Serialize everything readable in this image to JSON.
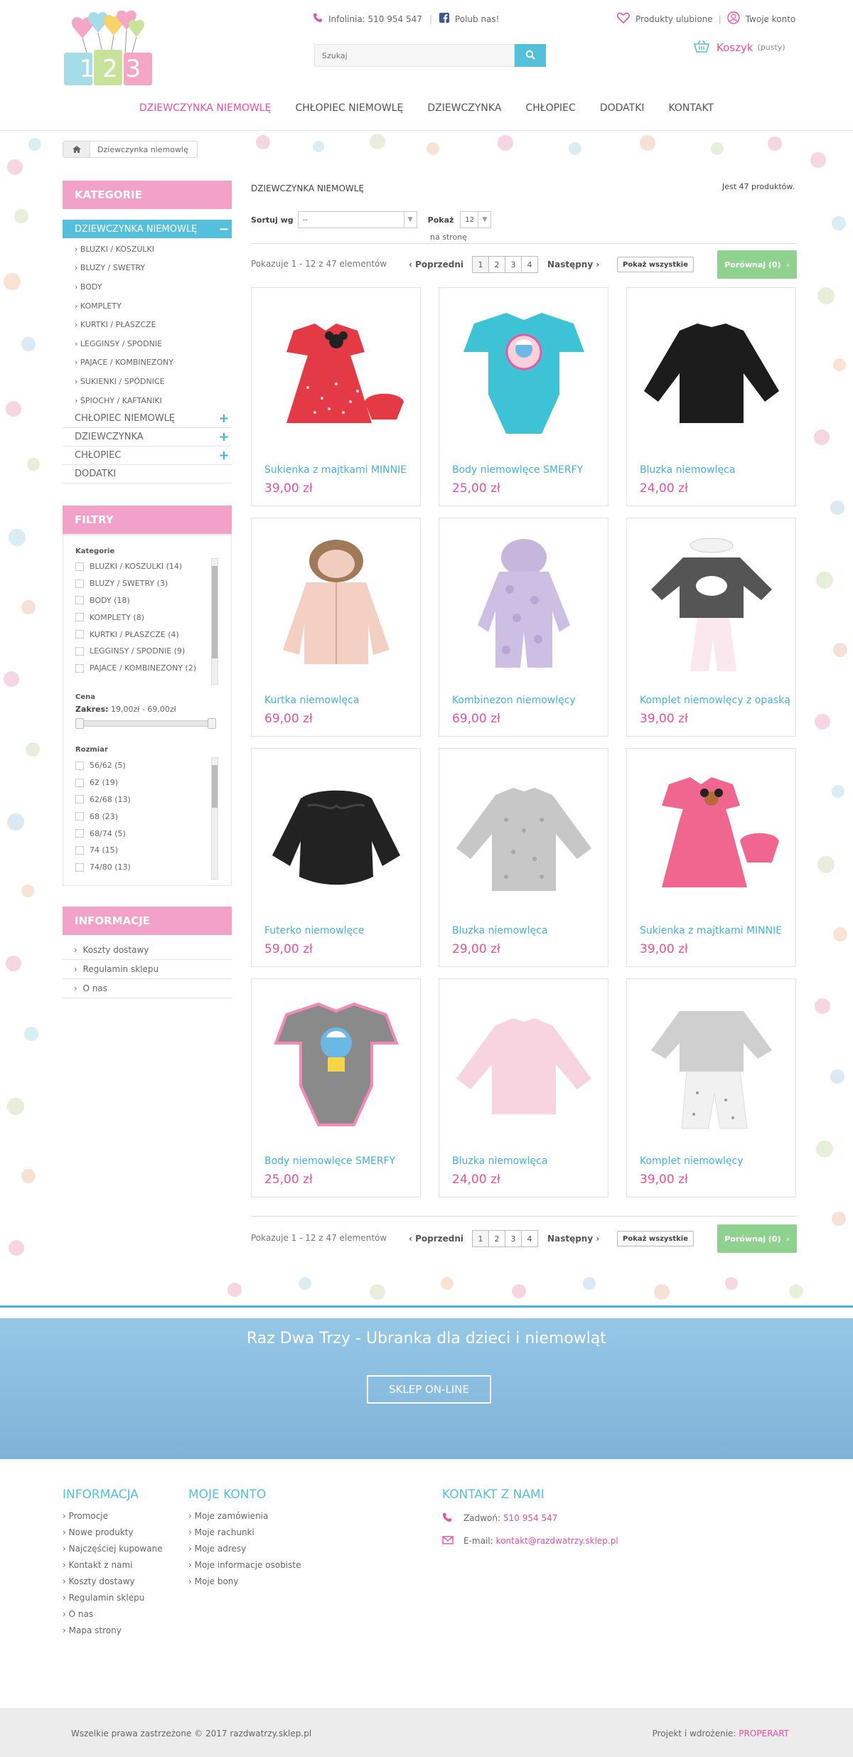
{
  "header": {
    "infoline_label": "Infolinia: 510 954 547",
    "facebook_label": "Polub nas!",
    "search_placeholder": "Szukaj",
    "favorites_label": "Produkty ulubione",
    "account_label": "Twoje konto",
    "cart_label": "Koszyk",
    "cart_status": "(pusty)",
    "logo_text": "1 2 3"
  },
  "nav": {
    "items": [
      "DZIEWCZYNKA NIEMOWLĘ",
      "CHŁOPIEC NIEMOWLĘ",
      "DZIEWCZYNKA",
      "CHŁOPIEC",
      "DODATKI",
      "KONTAKT"
    ],
    "active_index": 0
  },
  "breadcrumb": {
    "current": "Dziewczynka niemowlę"
  },
  "sidebar": {
    "categories_title": "KATEGORIE",
    "categories": [
      {
        "label": "DZIEWCZYNKA NIEMOWLĘ",
        "toggle": "−"
      },
      {
        "label": "CHŁOPIEC NIEMOWLĘ",
        "toggle": "+"
      },
      {
        "label": "DZIEWCZYNKA",
        "toggle": "+"
      },
      {
        "label": "CHŁOPIEC",
        "toggle": "+"
      },
      {
        "label": "DODATKI",
        "toggle": ""
      }
    ],
    "subcategories": [
      "BLUZKI / KOSZULKI",
      "BLUZY / SWETRY",
      "BODY",
      "KOMPLETY",
      "KURTKI / PŁASZCZE",
      "LEGGINSY / SPODNIE",
      "PAJACE / KOMBINEZONY",
      "SUKIENKI / SPÓDNICE",
      "ŚPIOCHY / KAFTANIKI"
    ],
    "filters_title": "FILTRY",
    "filter_category_title": "Kategorie",
    "filter_categories": [
      "BLUZKI / KOSZULKI (14)",
      "BLUZY / SWETRY (3)",
      "BODY (18)",
      "KOMPLETY (8)",
      "KURTKI / PŁASZCZE (4)",
      "LEGGINSY / SPODNIE (9)",
      "PAJACE / KOMBINEZONY (2)"
    ],
    "price_title": "Cena",
    "price_range_label": "Zakres:",
    "price_range_value": "19,00zł - 69,00zł",
    "size_title": "Rozmiar",
    "sizes": [
      "56/62 (5)",
      "62 (19)",
      "62/68 (13)",
      "68 (23)",
      "68/74 (5)",
      "74 (15)",
      "74/80 (13)"
    ],
    "info_title": "INFORMACJE",
    "info_links": [
      "Koszty dostawy",
      "Regulamin sklepu",
      "O nas"
    ]
  },
  "listing": {
    "title": "DZIEWCZYNKA NIEMOWLĘ",
    "count": "Jest 47 produktów.",
    "sort_label": "Sortuj wg",
    "sort_value": "--",
    "show_label": "Pokaż",
    "show_value": "12",
    "per_page_label": "na stronę",
    "showing": "Pokazuje 1 - 12 z 47 elementów",
    "prev": "Poprzedni",
    "next": "Następny",
    "pages": [
      "1",
      "2",
      "3",
      "4"
    ],
    "show_all": "Pokaż wszystkie",
    "compare": "Porównaj (0)"
  },
  "products": [
    {
      "name": "Sukienka z majtkami MINNIE",
      "price": "39,00 zł",
      "icon": "red-dress-image"
    },
    {
      "name": "Body niemowlęce SMERFY",
      "price": "25,00 zł",
      "icon": "blue-bodysuit-image"
    },
    {
      "name": "Bluzka niemowlęca",
      "price": "24,00 zł",
      "icon": "black-shirt-image"
    },
    {
      "name": "Kurtka niemowlęca",
      "price": "69,00 zł",
      "icon": "pink-jacket-image"
    },
    {
      "name": "Kombinezon niemowlęcy",
      "price": "69,00 zł",
      "icon": "lilac-overall-image"
    },
    {
      "name": "Komplet niemowlęcy z opaską",
      "price": "39,00 zł",
      "icon": "grey-set-image"
    },
    {
      "name": "Futerko niemowlęce",
      "price": "59,00 zł",
      "icon": "black-fur-image"
    },
    {
      "name": "Bluzka niemowlęca",
      "price": "29,00 zł",
      "icon": "grey-top-image"
    },
    {
      "name": "Sukienka z majtkami MINNIE",
      "price": "39,00 zł",
      "icon": "pink-dress-image"
    },
    {
      "name": "Body niemowlęce SMERFY",
      "price": "25,00 zł",
      "icon": "grey-bodysuit-image"
    },
    {
      "name": "Bluzka niemowlęca",
      "price": "24,00 zł",
      "icon": "pink-shirt-image"
    },
    {
      "name": "Komplet niemowlęcy",
      "price": "39,00 zł",
      "icon": "white-set-image"
    }
  ],
  "banner": {
    "title": "Raz Dwa Trzy - Ubranka dla dzieci i niemowląt",
    "button": "SKLEP ON-LINE"
  },
  "footer": {
    "info_title": "INFORMACJA",
    "info_links": [
      "Promocje",
      "Nowe produkty",
      "Najczęściej kupowane",
      "Kontakt z nami",
      "Koszty dostawy",
      "Regulamin sklepu",
      "O nas",
      "Mapa strony"
    ],
    "account_title": "MOJE KONTO",
    "account_links": [
      "Moje zamówienia",
      "Moje rachunki",
      "Moje adresy",
      "Moje informacje osobiste",
      "Moje bony"
    ],
    "contact_title": "KONTAKT Z NAMI",
    "phone_label": "Zadwoń:",
    "phone": "510 954 547",
    "email_label": "E-mail:",
    "email": "kontakt@razdwatrzy.sklep.pl",
    "copyright": "Wszelkie prawa zastrzeżone © 2017 razdwatrzy.sklep.pl",
    "credit_label": "Projekt i wdrożenie:",
    "credit": "PROPERART"
  },
  "colors": {
    "pink": "#e94fa0",
    "blue": "#55c0dc",
    "green": "#8fd18f",
    "sidebar_head": "#f2a1c8"
  }
}
